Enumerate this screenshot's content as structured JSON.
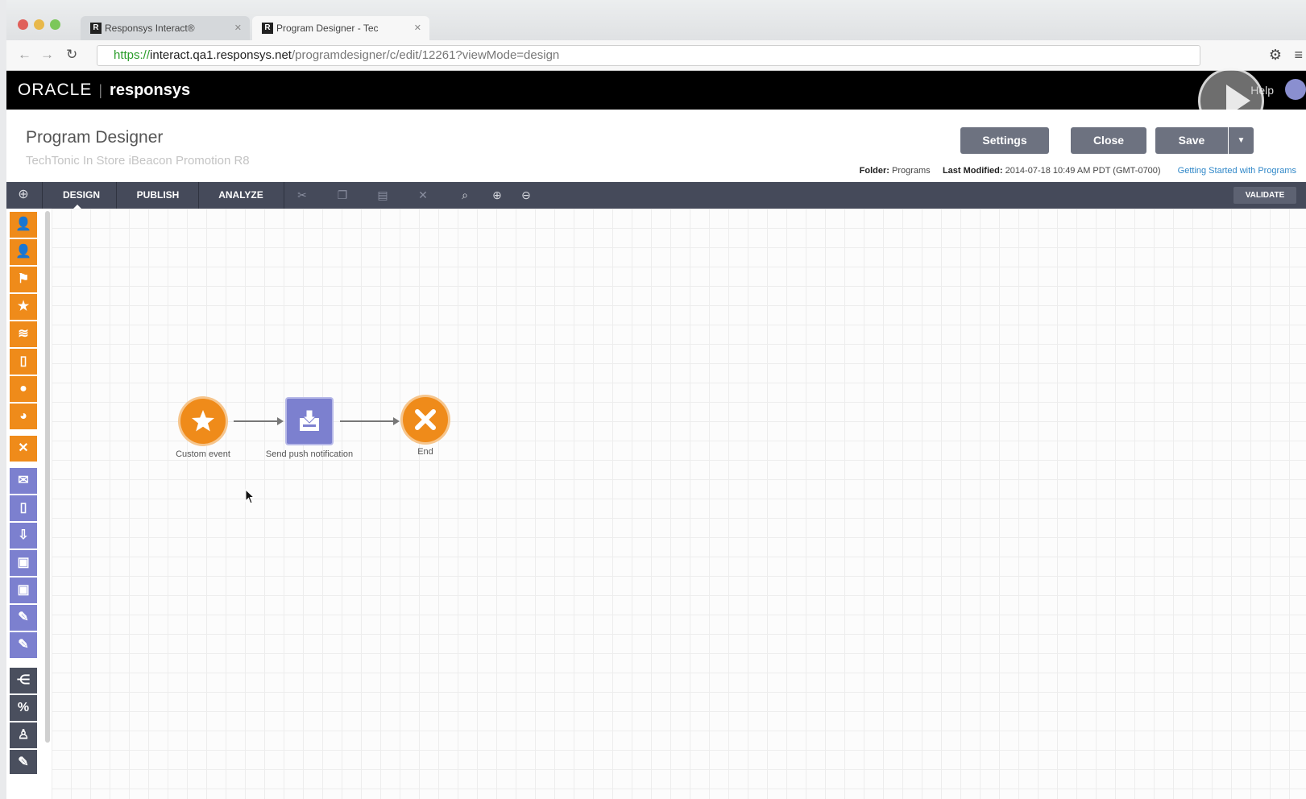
{
  "browser": {
    "tabs": [
      {
        "label": "Responsys Interact®",
        "favicon": "R",
        "active": false
      },
      {
        "label": "Program Designer - Tec",
        "favicon": "R",
        "active": true
      }
    ],
    "url": {
      "scheme": "https://",
      "host": "interact.qa1.responsys.net",
      "path": "/programdesigner/c/edit/12261?viewMode=design"
    }
  },
  "header": {
    "brand": "ORACLE",
    "product": "responsys",
    "help": "Help"
  },
  "page": {
    "title": "Program Designer",
    "subtitle": "TechTonic In Store iBeacon Promotion R8",
    "buttons": {
      "settings": "Settings",
      "close": "Close",
      "save": "Save"
    },
    "meta": {
      "folder_label": "Folder:",
      "folder_value": "Programs",
      "modified_label": "Last Modified:",
      "modified_value": "2014-07-18 10:49 AM PDT (GMT-0700)",
      "help_link": "Getting Started with Programs"
    }
  },
  "toolbar": {
    "tabs": [
      "DESIGN",
      "PUBLISH",
      "ANALYZE"
    ],
    "validate": "VALIDATE"
  },
  "palette": {
    "orange_icons": [
      "person-icon",
      "person-icon",
      "group-icon",
      "star-icon",
      "wifi-icon",
      "mobile-icon",
      "clock-icon",
      "timer-icon",
      "close-icon"
    ],
    "purple_icons": [
      "email-icon",
      "mobile-icon",
      "push-icon",
      "message-icon",
      "chat-icon",
      "form-icon",
      "form-icon"
    ],
    "dark_icons": [
      "split-icon",
      "percent-icon",
      "person-icon",
      "edit-icon"
    ]
  },
  "canvas": {
    "nodes": [
      {
        "label": "Custom event",
        "icon": "star-icon"
      },
      {
        "label": "Send push notification",
        "icon": "push-icon"
      },
      {
        "label": "End",
        "icon": "close-icon"
      }
    ]
  },
  "colors": {
    "orange": "#ef8b1a",
    "purple": "#7c80cf",
    "toolbar": "#454a5a",
    "button": "#6d7280"
  }
}
